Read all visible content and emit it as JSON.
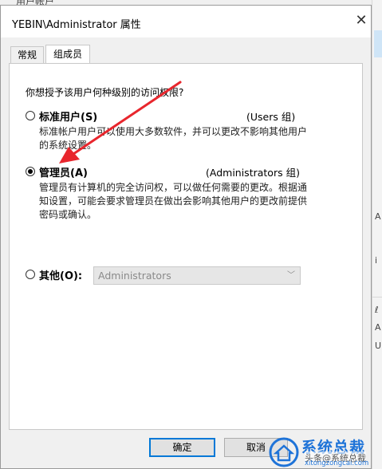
{
  "background_window": {
    "title_fragment": "用户帐户",
    "right_letters": [
      "A",
      "i",
      "ℓ",
      "A",
      "U"
    ]
  },
  "dialog": {
    "title": "YEBIN\\Administrator 属性",
    "tabs": [
      "常规",
      "组成员"
    ],
    "active_tab": "组成员",
    "question": "你想授予该用户何种级别的访问权限?",
    "options": {
      "standard": {
        "label": "标准用户(S)",
        "group": "(Users 组)",
        "description": "标准帐户用户可以使用大多数软件，并可以更改不影响其他用户的系统设置。",
        "selected": false
      },
      "admin": {
        "label": "管理员(A)",
        "group": "(Administrators 组)",
        "description": "管理员有计算机的完全访问权，可以做任何需要的更改。根据通知设置，可能会要求管理员在做出会影响其他用户的更改前提供密码或确认。",
        "selected": true
      },
      "other": {
        "label": "其他(O):",
        "select_value": "Administrators",
        "selected": false
      }
    },
    "buttons": {
      "ok": "确定",
      "cancel": "取消"
    }
  },
  "watermark": {
    "main": "系统总裁",
    "sub": "xitongzongcai.com",
    "header": "头条@系统总裁"
  },
  "colors": {
    "accent": "#0078d7",
    "annotation": "#e8262d",
    "watermark": "#1e73d8"
  }
}
